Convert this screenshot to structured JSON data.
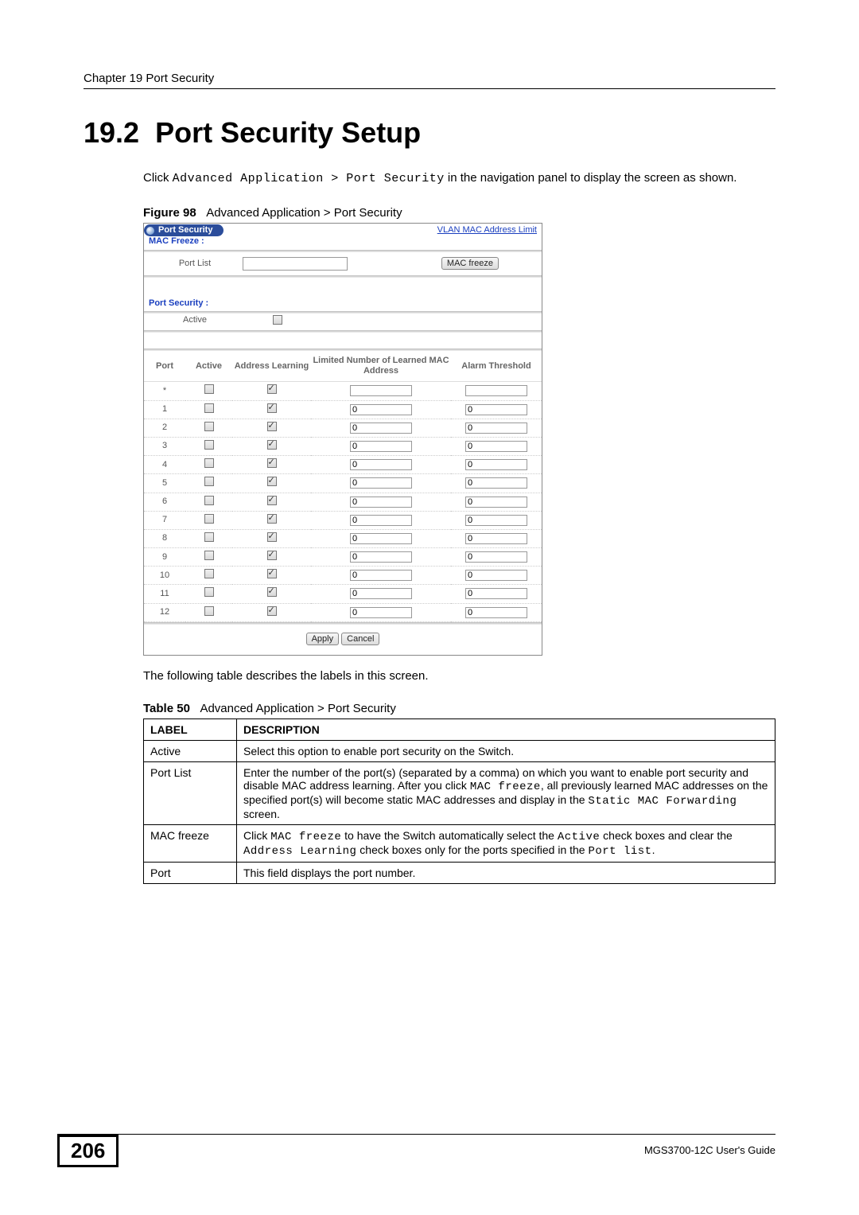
{
  "header": {
    "running": "Chapter 19 Port Security"
  },
  "section": {
    "number": "19.2",
    "title": "Port Security Setup",
    "intro_pre": "Click ",
    "intro_code": "Advanced Application > Port Security",
    "intro_post": " in the navigation panel to display the screen as shown."
  },
  "figure": {
    "label": "Figure 98",
    "caption": "Advanced Application > Port Security"
  },
  "screenshot": {
    "title": "Port Security",
    "link": "VLAN MAC Address Limit",
    "mac_freeze_label": "MAC Freeze :",
    "port_list_label": "Port List",
    "mac_freeze_btn": "MAC freeze",
    "port_security_label": "Port Security :",
    "active_label": "Active",
    "columns": {
      "port": "Port",
      "active": "Active",
      "addr_learning": "Address Learning",
      "limited": "Limited Number of Learned MAC Address",
      "alarm": "Alarm Threshold"
    },
    "rows": [
      {
        "port": "*",
        "active": false,
        "addr_learning": true,
        "limited": "",
        "alarm": ""
      },
      {
        "port": "1",
        "active": false,
        "addr_learning": true,
        "limited": "0",
        "alarm": "0"
      },
      {
        "port": "2",
        "active": false,
        "addr_learning": true,
        "limited": "0",
        "alarm": "0"
      },
      {
        "port": "3",
        "active": false,
        "addr_learning": true,
        "limited": "0",
        "alarm": "0"
      },
      {
        "port": "4",
        "active": false,
        "addr_learning": true,
        "limited": "0",
        "alarm": "0"
      },
      {
        "port": "5",
        "active": false,
        "addr_learning": true,
        "limited": "0",
        "alarm": "0"
      },
      {
        "port": "6",
        "active": false,
        "addr_learning": true,
        "limited": "0",
        "alarm": "0"
      },
      {
        "port": "7",
        "active": false,
        "addr_learning": true,
        "limited": "0",
        "alarm": "0"
      },
      {
        "port": "8",
        "active": false,
        "addr_learning": true,
        "limited": "0",
        "alarm": "0"
      },
      {
        "port": "9",
        "active": false,
        "addr_learning": true,
        "limited": "0",
        "alarm": "0"
      },
      {
        "port": "10",
        "active": false,
        "addr_learning": true,
        "limited": "0",
        "alarm": "0"
      },
      {
        "port": "11",
        "active": false,
        "addr_learning": true,
        "limited": "0",
        "alarm": "0"
      },
      {
        "port": "12",
        "active": false,
        "addr_learning": true,
        "limited": "0",
        "alarm": "0"
      }
    ],
    "apply_btn": "Apply",
    "cancel_btn": "Cancel"
  },
  "post_figure_text": "The following table describes the labels in this screen.",
  "table": {
    "label": "Table 50",
    "caption": "Advanced Application > Port Security",
    "headers": {
      "label": "LABEL",
      "desc": "DESCRIPTION"
    },
    "rows": [
      {
        "label": "Active",
        "desc_parts": [
          {
            "t": "text",
            "v": "Select this option to enable port security on the Switch."
          }
        ]
      },
      {
        "label": "Port List",
        "desc_parts": [
          {
            "t": "text",
            "v": "Enter the number of the port(s) (separated by a comma) on which you want to enable port security and disable MAC address learning. After you click "
          },
          {
            "t": "code",
            "v": "MAC freeze"
          },
          {
            "t": "text",
            "v": ", all previously learned MAC addresses on the specified port(s) will become static MAC addresses and display in the "
          },
          {
            "t": "code",
            "v": "Static MAC Forwarding"
          },
          {
            "t": "text",
            "v": " screen."
          }
        ]
      },
      {
        "label": "MAC freeze",
        "desc_parts": [
          {
            "t": "text",
            "v": "Click "
          },
          {
            "t": "code",
            "v": "MAC freeze"
          },
          {
            "t": "text",
            "v": " to have the Switch automatically select the "
          },
          {
            "t": "code",
            "v": "Active"
          },
          {
            "t": "text",
            "v": " check boxes and clear the "
          },
          {
            "t": "code",
            "v": "Address Learning"
          },
          {
            "t": "text",
            "v": " check boxes only for the ports specified in the "
          },
          {
            "t": "code",
            "v": "Port list"
          },
          {
            "t": "text",
            "v": "."
          }
        ]
      },
      {
        "label": "Port",
        "desc_parts": [
          {
            "t": "text",
            "v": "This field displays the port number."
          }
        ]
      }
    ]
  },
  "footer": {
    "page": "206",
    "guide": "MGS3700-12C User's Guide"
  }
}
